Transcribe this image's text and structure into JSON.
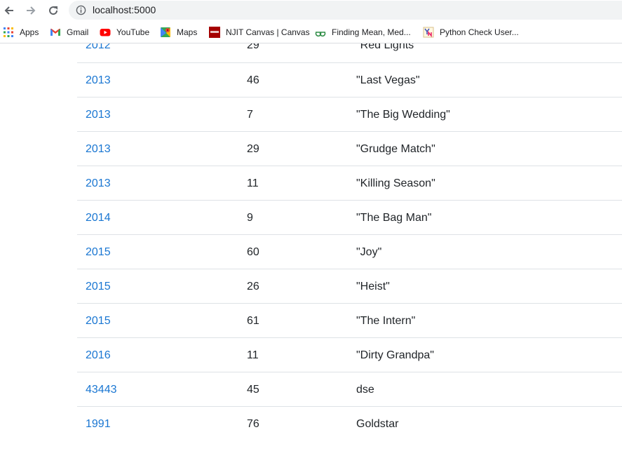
{
  "browser": {
    "url": "localhost:5000"
  },
  "bookmarks": [
    {
      "label": "Apps",
      "icon": "apps-grid-icon"
    },
    {
      "label": "Gmail",
      "icon": "gmail-icon"
    },
    {
      "label": "YouTube",
      "icon": "youtube-icon"
    },
    {
      "label": "Maps",
      "icon": "maps-icon"
    },
    {
      "label": "NJIT Canvas | Canvas",
      "icon": "njit-icon"
    },
    {
      "label": "Finding Mean, Med...",
      "icon": "geeksforgeeks-icon"
    },
    {
      "label": "Python Check User...",
      "icon": "python-doc-icon"
    }
  ],
  "table": {
    "rows": [
      {
        "year": "2012",
        "num": "29",
        "title": "\"Red Lights\""
      },
      {
        "year": "2013",
        "num": "46",
        "title": "\"Last Vegas\""
      },
      {
        "year": "2013",
        "num": "7",
        "title": "\"The Big Wedding\""
      },
      {
        "year": "2013",
        "num": "29",
        "title": "\"Grudge Match\""
      },
      {
        "year": "2013",
        "num": "11",
        "title": "\"Killing Season\""
      },
      {
        "year": "2014",
        "num": "9",
        "title": "\"The Bag Man\""
      },
      {
        "year": "2015",
        "num": "60",
        "title": "\"Joy\""
      },
      {
        "year": "2015",
        "num": "26",
        "title": "\"Heist\""
      },
      {
        "year": "2015",
        "num": "61",
        "title": "\"The Intern\""
      },
      {
        "year": "2016",
        "num": "11",
        "title": "\"Dirty Grandpa\""
      },
      {
        "year": "43443",
        "num": "45",
        "title": "dse"
      },
      {
        "year": "1991",
        "num": "76",
        "title": "Goldstar"
      }
    ]
  },
  "colors": {
    "link": "#1976d2",
    "row_border": "#dee2e6"
  }
}
